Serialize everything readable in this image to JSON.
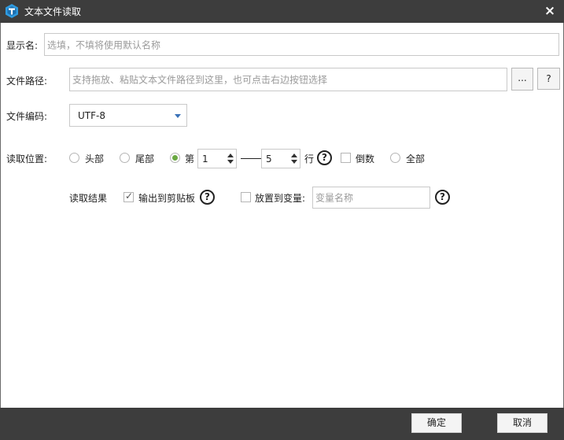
{
  "window": {
    "title": "文本文件读取",
    "close_icon": "×"
  },
  "display_name": {
    "label": "显示名:",
    "placeholder": "选填，不填将使用默认名称"
  },
  "file_path": {
    "label": "文件路径:",
    "placeholder": "支持拖放、粘贴文本文件路径到这里，也可点击右边按钮选择",
    "browse_label": "...",
    "help_label": "?"
  },
  "encoding": {
    "label": "文件编码:",
    "value": "UTF-8"
  },
  "read_position": {
    "label": "读取位置:",
    "options": [
      "头部",
      "尾部",
      "第"
    ],
    "start_line": "1",
    "end_line": "5",
    "unit": "行",
    "reverse_label": "倒数",
    "all_label": "全部",
    "help": "?"
  },
  "read_result": {
    "label": "读取结果",
    "clipboard_label": "输出到剪贴板",
    "clipboard_help": "?",
    "variable_label": "放置到变量:",
    "variable_placeholder": "变量名称",
    "variable_help": "?"
  },
  "footer": {
    "ok_label": "确定",
    "cancel_label": "取消"
  },
  "colors": {
    "titlebar": "#3d3d3d",
    "accent_radio": "#6aa842",
    "select_caret": "#3a72b8"
  }
}
